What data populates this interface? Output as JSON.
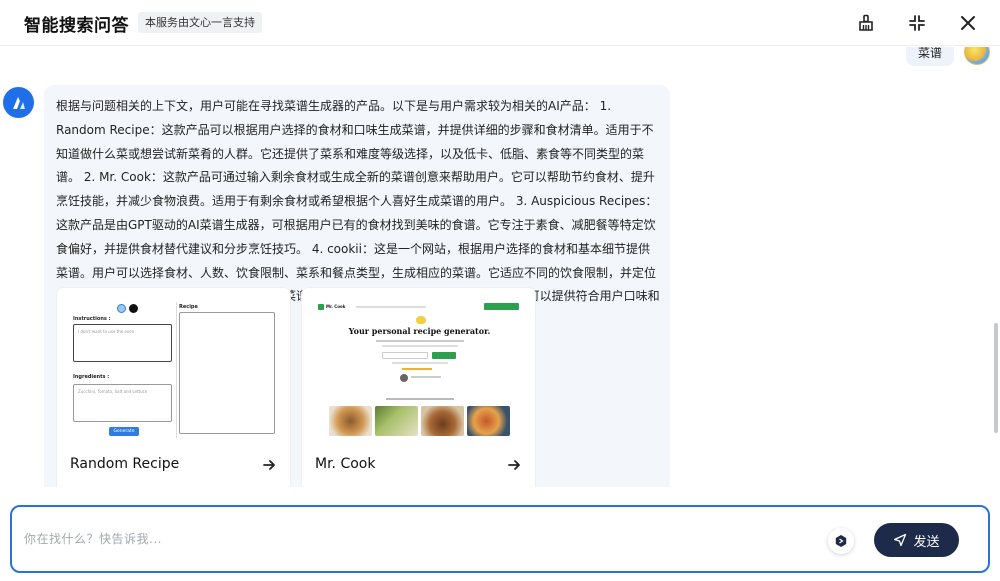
{
  "header": {
    "title": "智能搜索问答",
    "badge": "本服务由文心一言支持"
  },
  "user_message": {
    "text": "菜谱"
  },
  "bot_message": {
    "text": "根据与问题相关的上下文，用户可能在寻找菜谱生成器的产品。以下是与用户需求较为相关的AI产品： 1. Random Recipe：这款产品可以根据用户选择的食材和口味生成菜谱，并提供详细的步骤和食材清单。适用于不知道做什么菜或想尝试新菜肴的人群。它还提供了菜系和难度等级选择，以及低卡、低脂、素食等不同类型的菜谱。 2. Mr. Cook：这款产品可通过输入剩余食材或生成全新的菜谱创意来帮助用户。它可以帮助节约食材、提升烹饪技能，并减少食物浪费。适用于有剩余食材或希望根据个人喜好生成菜谱的用户。 3. Auspicious Recipes：这款产品是由GPT驱动的AI菜谱生成器，可根据用户已有的食材找到美味的食谱。它专注于素食、减肥餐等特定饮食偏好，并提供食材替代建议和分步烹饪技巧。 4. cookii：这是一个网站，根据用户选择的食材和基本细节提供菜谱。用户可以选择食材、人数、饮食限制、菜系和餐点类型，生成相应的菜谱。它适应不同的饮食限制，并定位于帮助用户快速找到适合自己口味和需求的菜谱。 根据用户的搜索需求，以上四款AI产品可以提供符合用户口味和需求的菜谱。"
  },
  "cards": [
    {
      "title": "Random Recipe",
      "thumb": {
        "instructions_label": "Instructions :",
        "instructions_placeholder": "I don't want to use the oven",
        "ingredients_label": "Ingredients :",
        "ingredients_placeholder": "Zucchini, Tomato, Salt and Lettuce",
        "generate_label": "Generate",
        "recipe_label": "Recipe"
      }
    },
    {
      "title": "Mr. Cook",
      "thumb": {
        "brand": "Mr. Cook",
        "headline": "Your personal recipe generator."
      }
    }
  ],
  "input": {
    "placeholder": "你在找什么？快告诉我...",
    "send_label": "发送"
  },
  "colors": {
    "accent": "#2b72d6",
    "send_button": "#1d2a4a",
    "bubble_bg": "#f3f7fc",
    "bot_avatar": "#1f6fe8"
  }
}
